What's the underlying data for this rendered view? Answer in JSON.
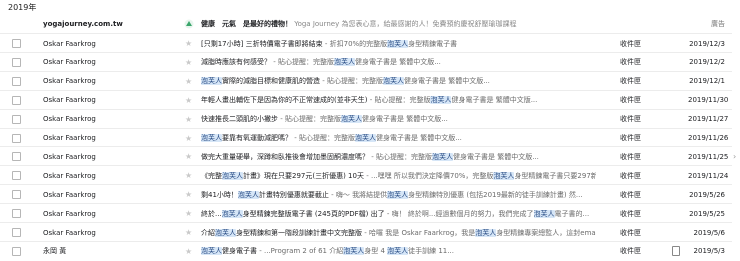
{
  "year_header": "2019年",
  "ad": {
    "sender": "yogajourney.com.tw",
    "title": "健康　元氣　是最好的禮物！",
    "snippet": "Yoga Journey 為您表心意，給最感謝的人！免費預約慶祝舒壓瑜珈課程",
    "badge": "廣告"
  },
  "emails": [
    {
      "sender": "Oskar Faarkrog",
      "subject": "[只剩17小時] 三折特價電子書即將結束",
      "snippet": "折扣70%的完整版泡芙人身型精鍊電子書",
      "label": "收件匣",
      "date": "2019/12/3",
      "attachment": false
    },
    {
      "sender": "Oskar Faarkrog",
      "subject": "減脂時應該有何感受？",
      "snippet": "貼心提醒：完整版泡芙人健身電子書是 繁體中文版...",
      "label": "收件匣",
      "date": "2019/12/2",
      "attachment": false
    },
    {
      "sender": "Oskar Faarkrog",
      "subject": "泡芙人實際的減脂目標和健康肌的營造",
      "snippet": "貼心提醒：完整版泡芙人健身電子書是 繁體中文版...",
      "label": "收件匣",
      "date": "2019/12/1",
      "attachment": false
    },
    {
      "sender": "Oskar Faarkrog",
      "subject": "年輕人畫出輔佐下是因為你的不正常速成的(並非天生)",
      "snippet": "貼心提醒：完整版泡芙人健身電子書是 繁體中文版...",
      "label": "收件匣",
      "date": "2019/11/30",
      "attachment": false
    },
    {
      "sender": "Oskar Faarkrog",
      "subject": "快速推長二頭肌的小撇步",
      "snippet": "貼心提醒：完整版泡芙人健身電子書是 繁體中文版...",
      "label": "收件匣",
      "date": "2019/11/27",
      "attachment": false
    },
    {
      "sender": "Oskar Faarkrog",
      "subject": "泡芙人要靠有氧運動減肥嗎？",
      "snippet": "貼心提醒：完整版泡芙人健身電子書是 繁體中文版...",
      "label": "收件匣",
      "date": "2019/11/26",
      "attachment": false
    },
    {
      "sender": "Oskar Faarkrog",
      "subject": "做完大重量硬舉，深蹲和臥推後會增加墨固酮濃度嗎？",
      "snippet": "貼心提醒：完整版泡芙人健身電子書是 繁體中文版...",
      "label": "收件匣",
      "date": "2019/11/25",
      "attachment": false
    },
    {
      "sender": "Oskar Faarkrog",
      "subject": "《完整泡芙人計畫》現在只要297元(三折優惠) 10天",
      "snippet": "...嘿嘿 所以我們決定降價70%，完整版泡芙人身型精鍊電子書只要297新台幣，期限...",
      "label": "收件匣",
      "date": "2019/11/24",
      "attachment": false
    },
    {
      "sender": "Oskar Faarkrog",
      "subject": "剩41小時！泡芙人計畫特別優惠就要截止",
      "snippet": "嗨～ 我將結提供泡芙人身型精鍊特別優惠 (包括2019最新的徒手訓練計畫) 然...",
      "label": "收件匣",
      "date": "2019/5/26",
      "attachment": false
    },
    {
      "sender": "Oskar Faarkrog",
      "subject": "終於...泡芙人身型精鍊完整版電子書 (245頁的PDF檔) 出了",
      "snippet": "嗨！ 終於啊...經過數個月的努力，我們完成了泡芙人電子書的...",
      "label": "收件匣",
      "date": "2019/5/25",
      "attachment": false
    },
    {
      "sender": "Oskar Faarkrog",
      "subject": "介紹泡芙人身型精鍊和第一階段訓練計畫中文完整版",
      "snippet": "哈囉 我是 Oskar Faarkrog，我是泡芙人身型精鍊專案總監人，這封email是我寄的...",
      "label": "收件匣",
      "date": "2019/5/6",
      "attachment": false
    },
    {
      "sender": "永岡 黃",
      "subject": "泡芙人健身電子書",
      "snippet": "...Program 2 of 61 介紹泡芙人身型 4 泡芙人徒手訓練 11...",
      "label": "收件匣",
      "date": "2019/5/3",
      "attachment": true
    }
  ],
  "colors": {
    "highlight_bg": "#d6e6f7",
    "star": "#c9c9c9"
  }
}
